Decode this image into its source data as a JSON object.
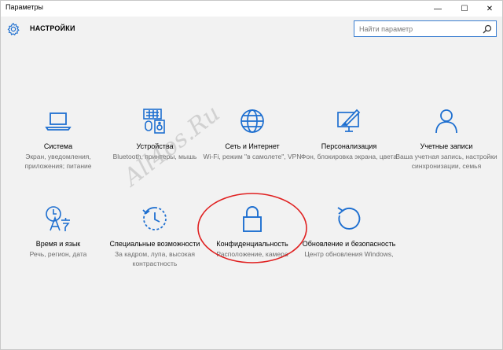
{
  "window": {
    "title": "Параметры",
    "minimize_glyph": "—",
    "maximize_glyph": "☐",
    "close_glyph": "✕"
  },
  "header": {
    "heading": "НАСТРОЙКИ",
    "icon": "gear-icon"
  },
  "search": {
    "placeholder": "Найти параметр",
    "icon": "search-icon"
  },
  "tiles": [
    {
      "name": "Система",
      "desc": "Экран, уведомления, приложения; питание",
      "icon": "laptop-icon"
    },
    {
      "name": "Устройства",
      "desc": "Bluetooth, принтеры, мышь",
      "icon": "devices-icon"
    },
    {
      "name": "Сеть и Интернет",
      "desc": "Wi-Fi, режим \"в самолете\", VPN",
      "icon": "globe-icon"
    },
    {
      "name": "Персонализация",
      "desc": "Фон, блокировка экрана, цвета",
      "icon": "personalization-icon"
    },
    {
      "name": "Учетные записи",
      "desc": "Ваша учетная запись, настройки синхронизации, семья",
      "icon": "person-icon"
    },
    {
      "name": "Время и язык",
      "desc": "Речь, регион, дата",
      "icon": "time-language-icon"
    },
    {
      "name": "Специальные возможности",
      "desc": "За кадром, лупа, высокая контрастность",
      "icon": "accessibility-icon"
    },
    {
      "name": "Конфиденциальность",
      "desc": "Расположение, камера",
      "icon": "lock-icon"
    },
    {
      "name": "Обновление и безопасность",
      "desc": "Центр обновления Windows,",
      "icon": "update-icon"
    }
  ],
  "watermark": "All4os.Ru",
  "colors": {
    "accent": "#1e6fd0",
    "highlight_circle": "#e02020",
    "description_text": "#6d6d6d"
  }
}
